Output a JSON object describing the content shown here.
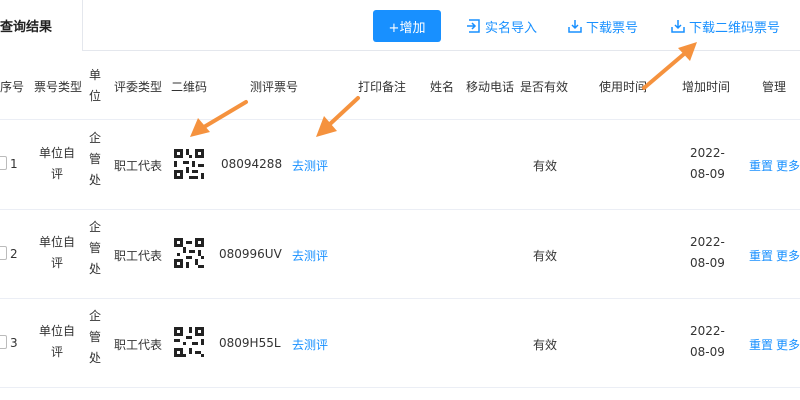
{
  "tabs": {
    "active": "查询结果"
  },
  "toolbar": {
    "add_label": "+增加",
    "import_label": "实名导入",
    "download_label": "下载票号",
    "download_qr_label": "下载二维码票号"
  },
  "table": {
    "headers": {
      "seq": "序号",
      "ticket_type": "票号类型",
      "unit": [
        "单",
        "位"
      ],
      "rater_type": "评委类型",
      "qr": "二维码",
      "ticket_no": "测评票号",
      "print_note": "打印备注",
      "name": "姓名",
      "phone": "移动电话",
      "valid": "是否有效",
      "use_time": "使用时间",
      "add_time": "增加时间",
      "manage": "管理"
    },
    "rows": [
      {
        "seq": "1",
        "ticket_type": [
          "单位自",
          "评"
        ],
        "unit": [
          "企",
          "管",
          "处"
        ],
        "rater_type": "职工代表",
        "ticket_no": "08094288",
        "eval_link": "去测评",
        "valid": "有效",
        "add_time": [
          "2022-",
          "08-09"
        ],
        "reset": "重置",
        "more": "更多"
      },
      {
        "seq": "2",
        "ticket_type": [
          "单位自",
          "评"
        ],
        "unit": [
          "企",
          "管",
          "处"
        ],
        "rater_type": "职工代表",
        "ticket_no": "080996UV",
        "eval_link": "去测评",
        "valid": "有效",
        "add_time": [
          "2022-",
          "08-09"
        ],
        "reset": "重置",
        "more": "更多"
      },
      {
        "seq": "3",
        "ticket_type": [
          "单位自",
          "评"
        ],
        "unit": [
          "企",
          "管",
          "处"
        ],
        "rater_type": "职工代表",
        "ticket_no": "0809H55L",
        "eval_link": "去测评",
        "valid": "有效",
        "add_time": [
          "2022-",
          "08-09"
        ],
        "reset": "重置",
        "more": "更多"
      }
    ]
  },
  "colors": {
    "accent": "#1890ff",
    "annotation_arrow": "#f5923e"
  }
}
